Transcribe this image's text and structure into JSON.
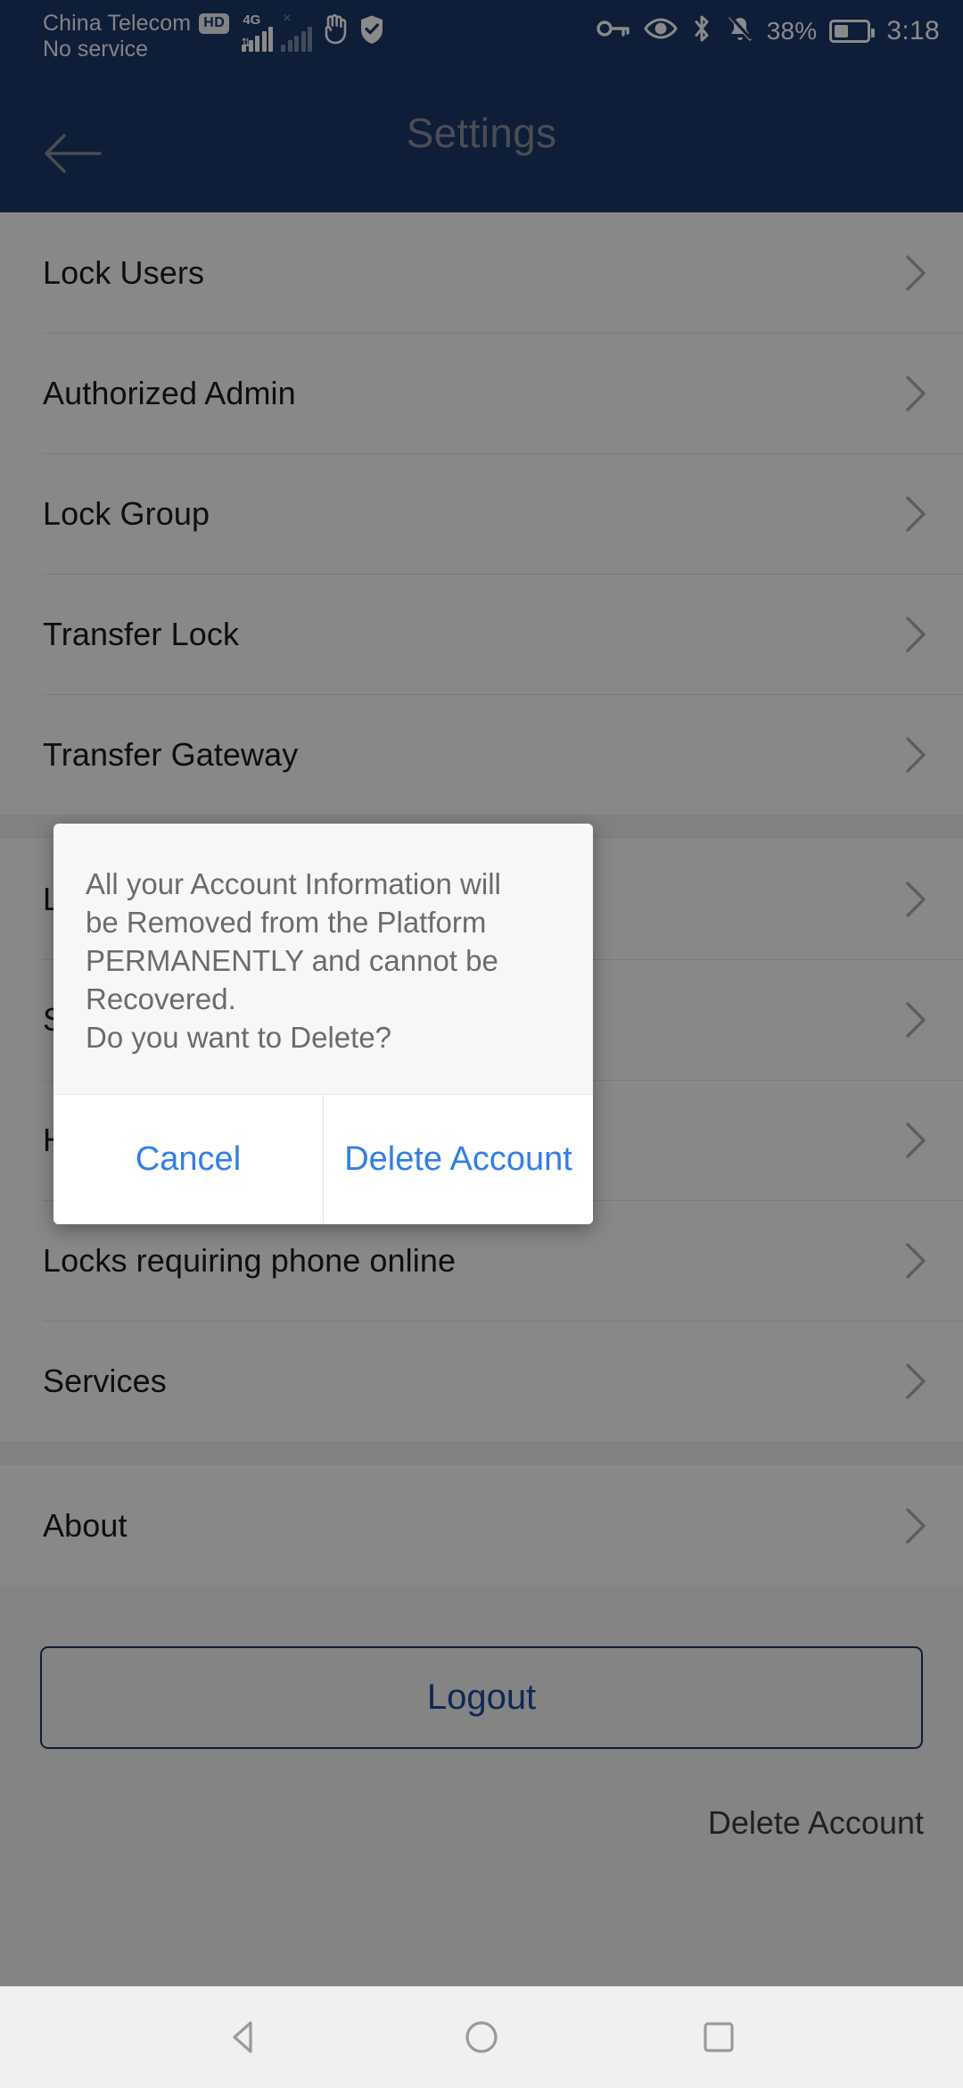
{
  "status_bar": {
    "carrier": "China Telecom",
    "hd_badge": "HD",
    "no_service": "No service",
    "network_type": "4G",
    "battery_percent": "38%",
    "time": "3:18",
    "icons": [
      "vpn-key-icon",
      "eye-icon",
      "bluetooth-icon",
      "notifications-muted-icon",
      "battery-icon"
    ]
  },
  "app_bar": {
    "title": "Settings",
    "back_label": "back-arrow-icon"
  },
  "settings_list": {
    "group_one": [
      {
        "label": "Lock Users"
      },
      {
        "label": "Authorized Admin"
      },
      {
        "label": "Lock Group"
      },
      {
        "label": "Transfer Lock"
      },
      {
        "label": "Transfer Gateway"
      }
    ],
    "group_two": [
      {
        "label": "Language"
      },
      {
        "label": "Sound"
      },
      {
        "label": "History"
      },
      {
        "label": "Locks requiring phone online"
      },
      {
        "label": "Services"
      }
    ],
    "group_three": [
      {
        "label": "About"
      }
    ]
  },
  "bottom": {
    "logout_label": "Logout",
    "delete_account_label": "Delete Account"
  },
  "dialog": {
    "message": "All your Account Information will\nbe Removed from the Platform\nPERMANENTLY and cannot be Recovered.\nDo you want to Delete?",
    "cancel_label": "Cancel",
    "confirm_label": "Delete Account"
  },
  "nav_bar": {
    "back": "nav-back-icon",
    "home": "nav-home-icon",
    "recents": "nav-recents-icon"
  },
  "colors": {
    "header_blue": "#1b3668",
    "accent_blue": "#2f7def",
    "logout_border": "#1b3668",
    "scrim": "rgba(0,0,0,0.46)"
  }
}
